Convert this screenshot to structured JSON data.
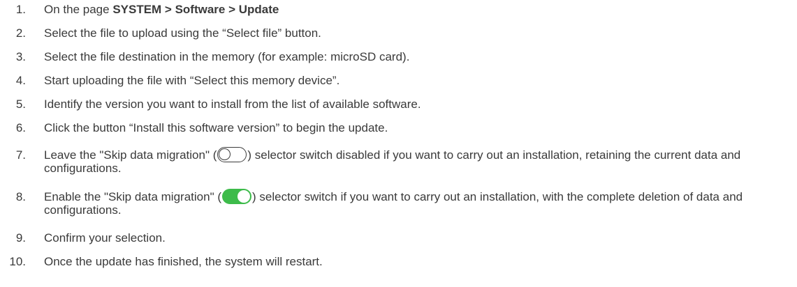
{
  "steps": [
    {
      "num": "1.",
      "prefix": "On the page ",
      "bold": "SYSTEM > Software > Update"
    },
    {
      "num": "2.",
      "text": "Select the file to upload using the “Select file” button."
    },
    {
      "num": "3.",
      "text": "Select the file destination in the memory (for example: microSD card)."
    },
    {
      "num": "4.",
      "text": "Start uploading the file with “Select this memory device”."
    },
    {
      "num": "5.",
      "text": "Identify the version you want to install from the list of available software."
    },
    {
      "num": "6.",
      "text": "Click the button “Install this software version” to begin the update."
    },
    {
      "num": "7.",
      "before": "Leave the \"Skip data migration\" (",
      "after": ") selector switch disabled if you want to carry out an installation, retaining the current data and configurations.",
      "toggle_state": "off"
    },
    {
      "num": "8.",
      "before": "Enable the \"Skip data migration\" (",
      "after": ") selector switch if you want to carry out an installation, with the complete deletion of data and configurations.",
      "toggle_state": "on"
    },
    {
      "num": "9.",
      "text": "Confirm your selection."
    },
    {
      "num": "10.",
      "text": "Once the update has finished, the system will restart."
    }
  ],
  "colors": {
    "text": "#3a3a3a",
    "toggle_on": "#3dbb4a"
  },
  "icons": [
    "toggle-off-icon",
    "toggle-on-icon"
  ]
}
